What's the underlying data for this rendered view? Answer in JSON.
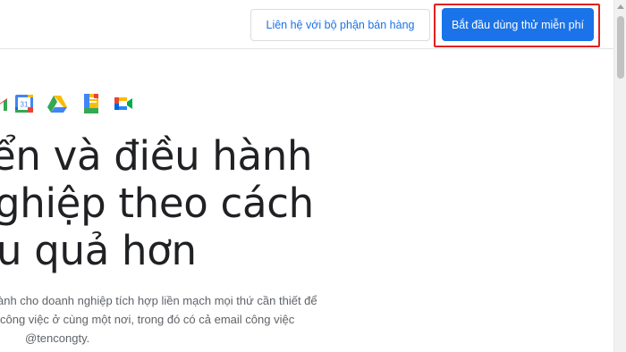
{
  "header": {
    "contact_sales_label": "Liên hệ với bộ phận bán hàng",
    "start_trial_label": "Bắt đầu dùng thử miễn phí",
    "highlight_color": "#e02020",
    "accent_color": "#1a73e8"
  },
  "apps": [
    {
      "name": "gmail-icon"
    },
    {
      "name": "calendar-icon",
      "text": "31"
    },
    {
      "name": "drive-icon"
    },
    {
      "name": "docs-icon"
    },
    {
      "name": "meet-icon"
    }
  ],
  "hero": {
    "line1": "ển và điều hành",
    "line2": "ghiệp theo cách",
    "line3": "u quả hơn"
  },
  "description": {
    "line1": "ành cho doanh nghiệp tích hợp liền mạch mọi thứ cần thiết để",
    "line2": "công việc ở cùng một nơi, trong đó có cả email công việc",
    "line3": "@tencongty."
  }
}
